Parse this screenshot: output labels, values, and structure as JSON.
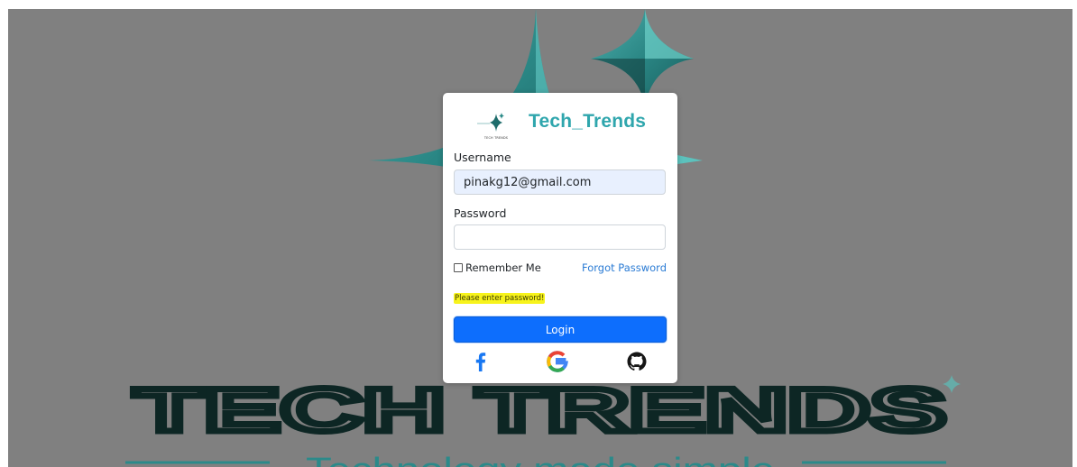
{
  "login": {
    "brand": "Tech_Trends",
    "logo_caption": "TECH TRENDS",
    "username_label": "Username",
    "username_value": "pinakg12@gmail.com",
    "password_label": "Password",
    "password_value": "",
    "remember_label": "Remember Me",
    "remember_checked": false,
    "forgot_label": "Forgot Password",
    "error_message": "Please enter password!",
    "login_button": "Login",
    "social": [
      {
        "name": "facebook-icon",
        "color": "#1877f2"
      },
      {
        "name": "google-icon",
        "colors": [
          "#4285f4",
          "#ea4335",
          "#fbbc05",
          "#34a853"
        ]
      },
      {
        "name": "github-icon",
        "color": "#161616"
      }
    ]
  },
  "background": {
    "title": "TECH TRENDS",
    "tagline": "Technology made simple",
    "overlay_color": "#808080",
    "accent": "#2b8a8a",
    "title_color": "#0d2624"
  }
}
